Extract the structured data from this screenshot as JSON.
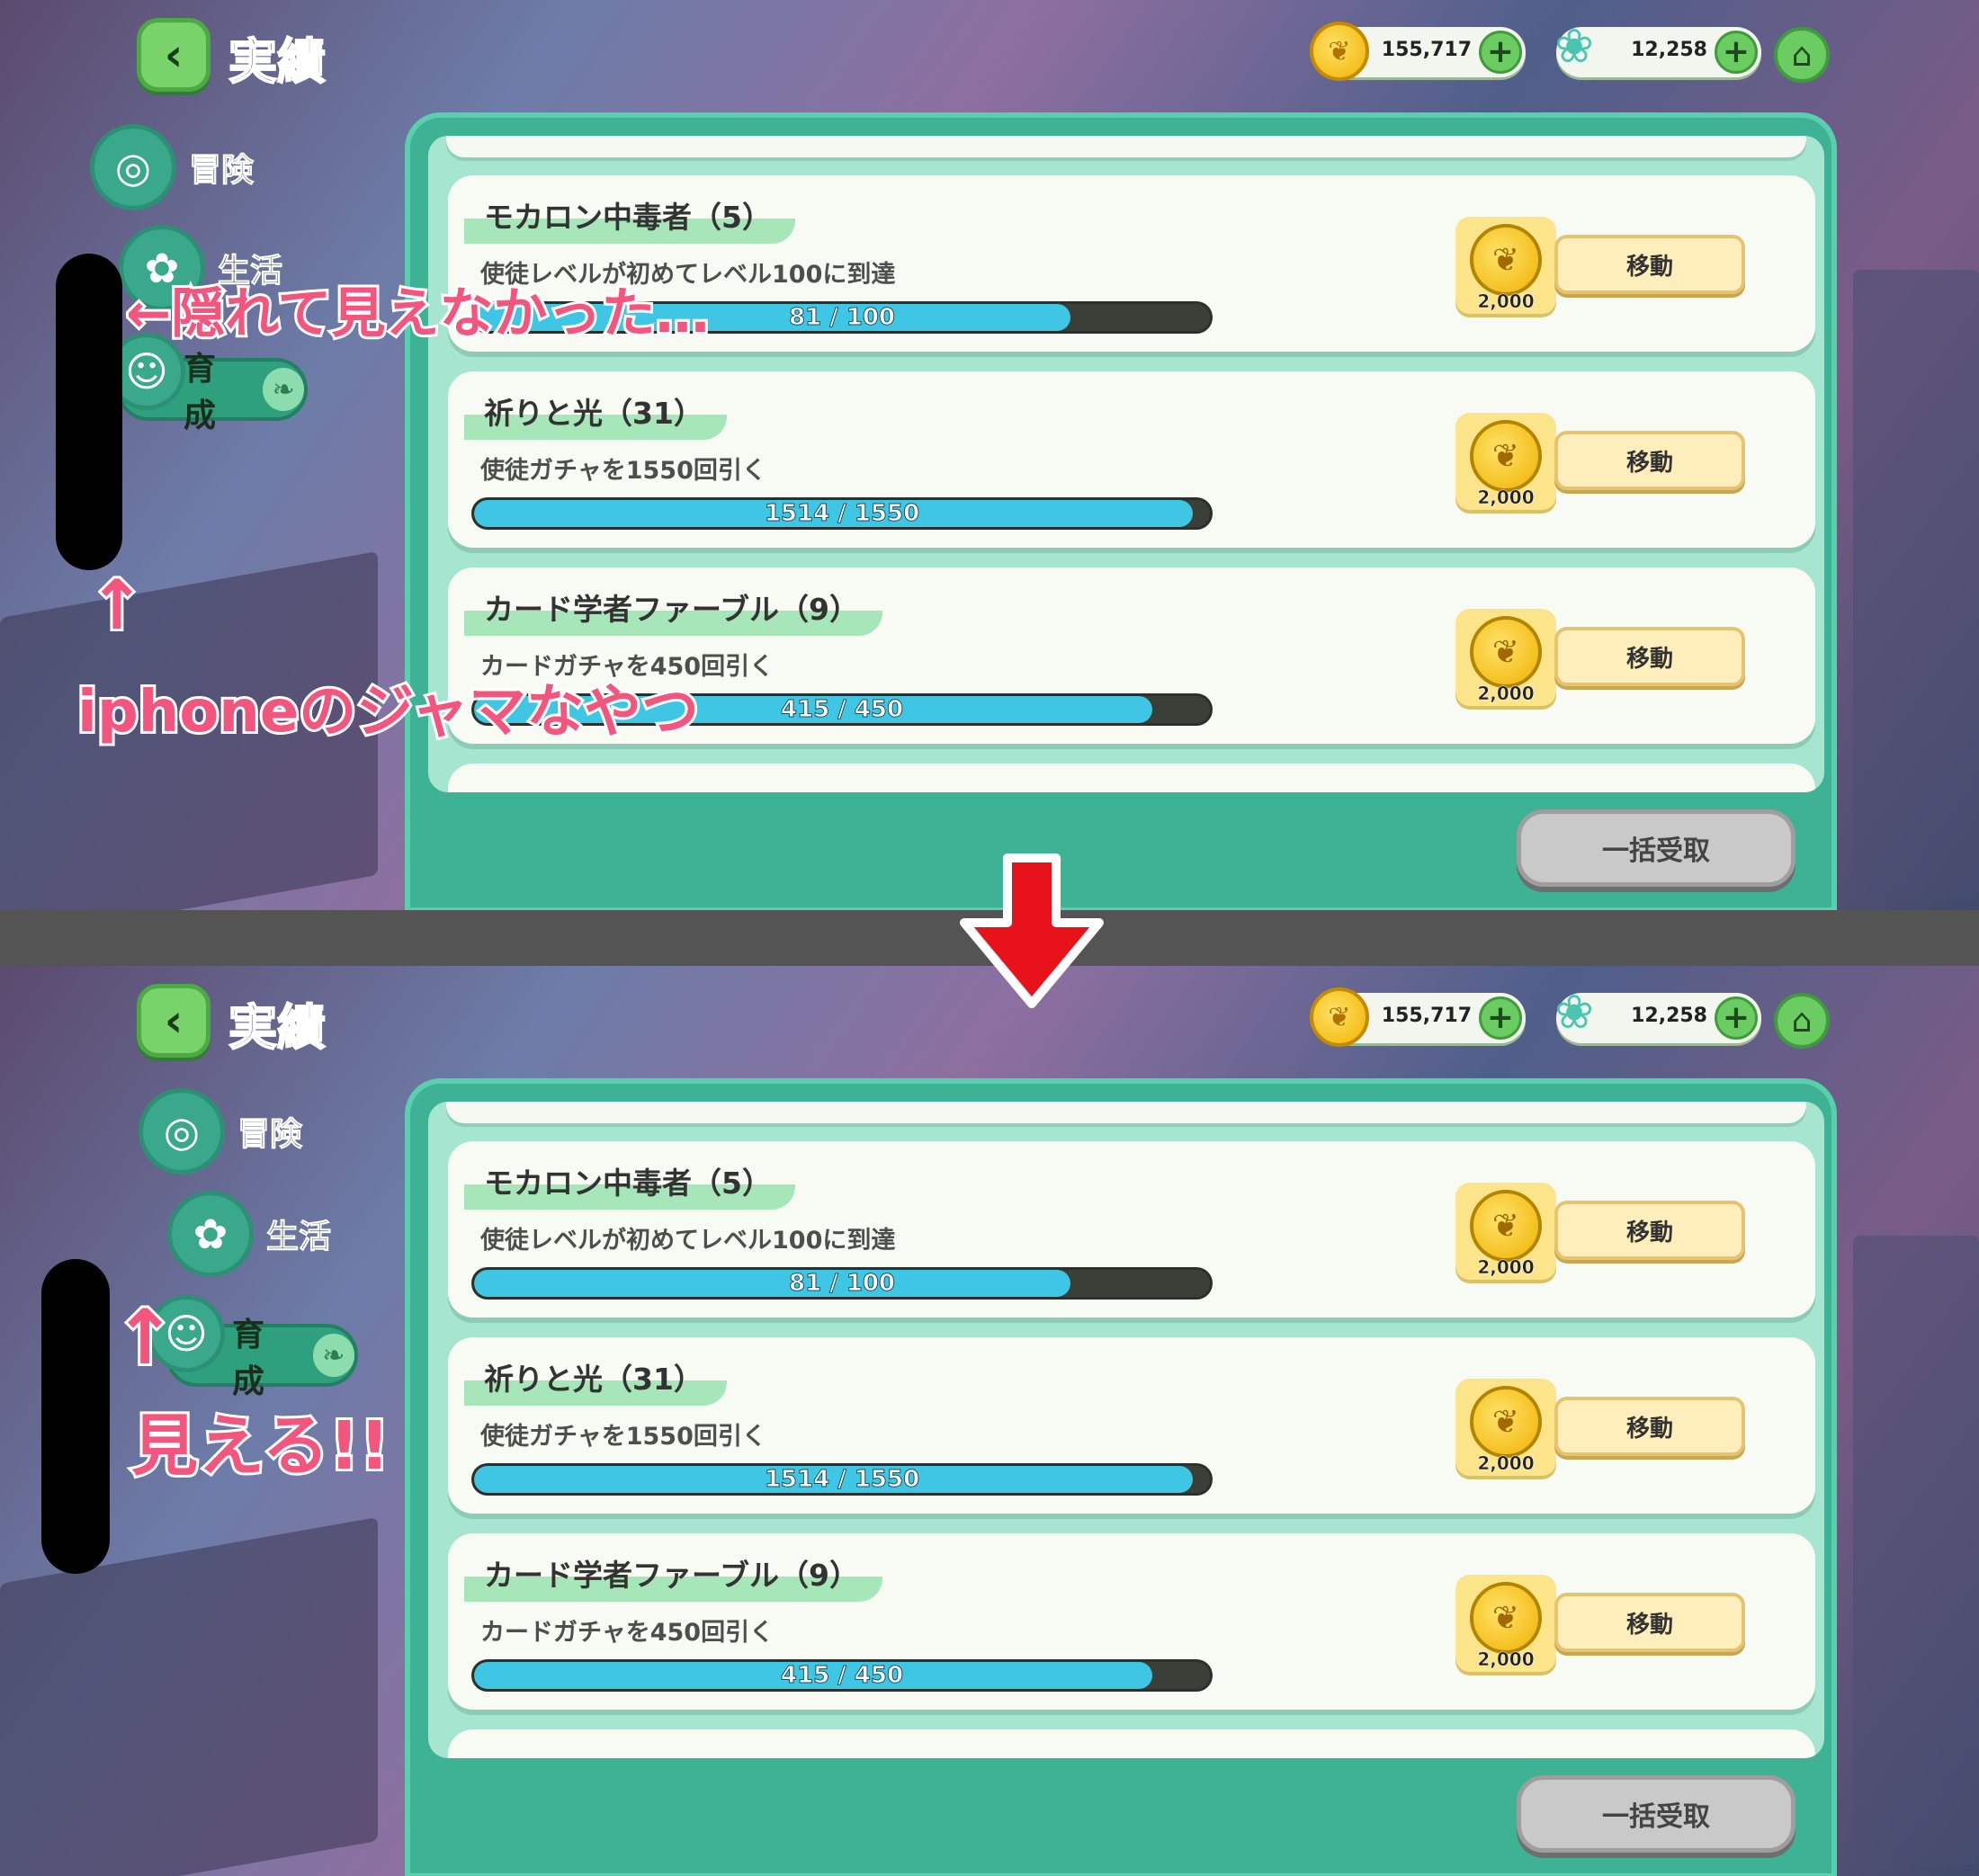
{
  "header": {
    "title": "実績",
    "coins": "155,717",
    "gems": "12,258"
  },
  "tabs": [
    {
      "label": "冒険"
    },
    {
      "label": "生活"
    },
    {
      "label": "育成"
    }
  ],
  "achievements": [
    {
      "title": "モカロン中毒者（5）",
      "desc": "使徒レベルが初めてレベル100に到達",
      "progress_text": "81 / 100",
      "progress": 0.81,
      "reward": "2,000",
      "button": "移動"
    },
    {
      "title": "祈りと光（31）",
      "desc": "使徒ガチャを1550回引く",
      "progress_text": "1514 / 1550",
      "progress": 0.977,
      "reward": "2,000",
      "button": "移動"
    },
    {
      "title": "カード学者ファーブル（9）",
      "desc": "カードガチャを450回引く",
      "progress_text": "415 / 450",
      "progress": 0.922,
      "reward": "2,000",
      "button": "移動"
    }
  ],
  "bulk_button": "一括受取",
  "annotations": {
    "hidden": "←隠れて見えなかった…",
    "iphone": "iphoneのジャマなやつ",
    "up_arrow": "↑",
    "visible": "見える!!"
  },
  "colors": {
    "annotation": "#f2557e",
    "accent": "#3db294",
    "arrow": "#e8131a"
  }
}
